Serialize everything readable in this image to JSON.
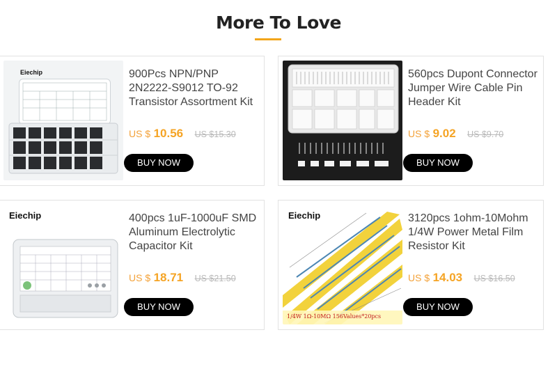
{
  "section": {
    "title": "More To Love"
  },
  "products": [
    {
      "name": "900Pcs NPN/PNP 2N2222-S9012 TO-92 Transistor Assortment Kit",
      "currency": "US $",
      "price": "10.56",
      "original_price": "US $15.30",
      "button": "BUY NOW",
      "image_brand": "Eiechip"
    },
    {
      "name": "560pcs Dupont Connector Jumper Wire Cable Pin Header Kit",
      "currency": "US $",
      "price": "9.02",
      "original_price": "US $9.70",
      "button": "BUY NOW"
    },
    {
      "name": "400pcs 1uF-1000uF SMD Aluminum Electrolytic Capacitor Kit",
      "currency": "US $",
      "price": "18.71",
      "original_price": "US $21.50",
      "button": "BUY NOW",
      "image_brand": "Eiechip"
    },
    {
      "name": "3120pcs 1ohm-10Mohm 1/4W Power Metal Film Resistor Kit",
      "currency": "US $",
      "price": "14.03",
      "original_price": "US $16.50",
      "button": "BUY NOW",
      "image_brand": "Eiechip",
      "image_caption": "1/4W 1Ω-10MΩ 156Values*20pcs"
    }
  ],
  "colors": {
    "accent": "#f5a425",
    "button_bg": "#000000",
    "strike": "#b9b9b9"
  }
}
